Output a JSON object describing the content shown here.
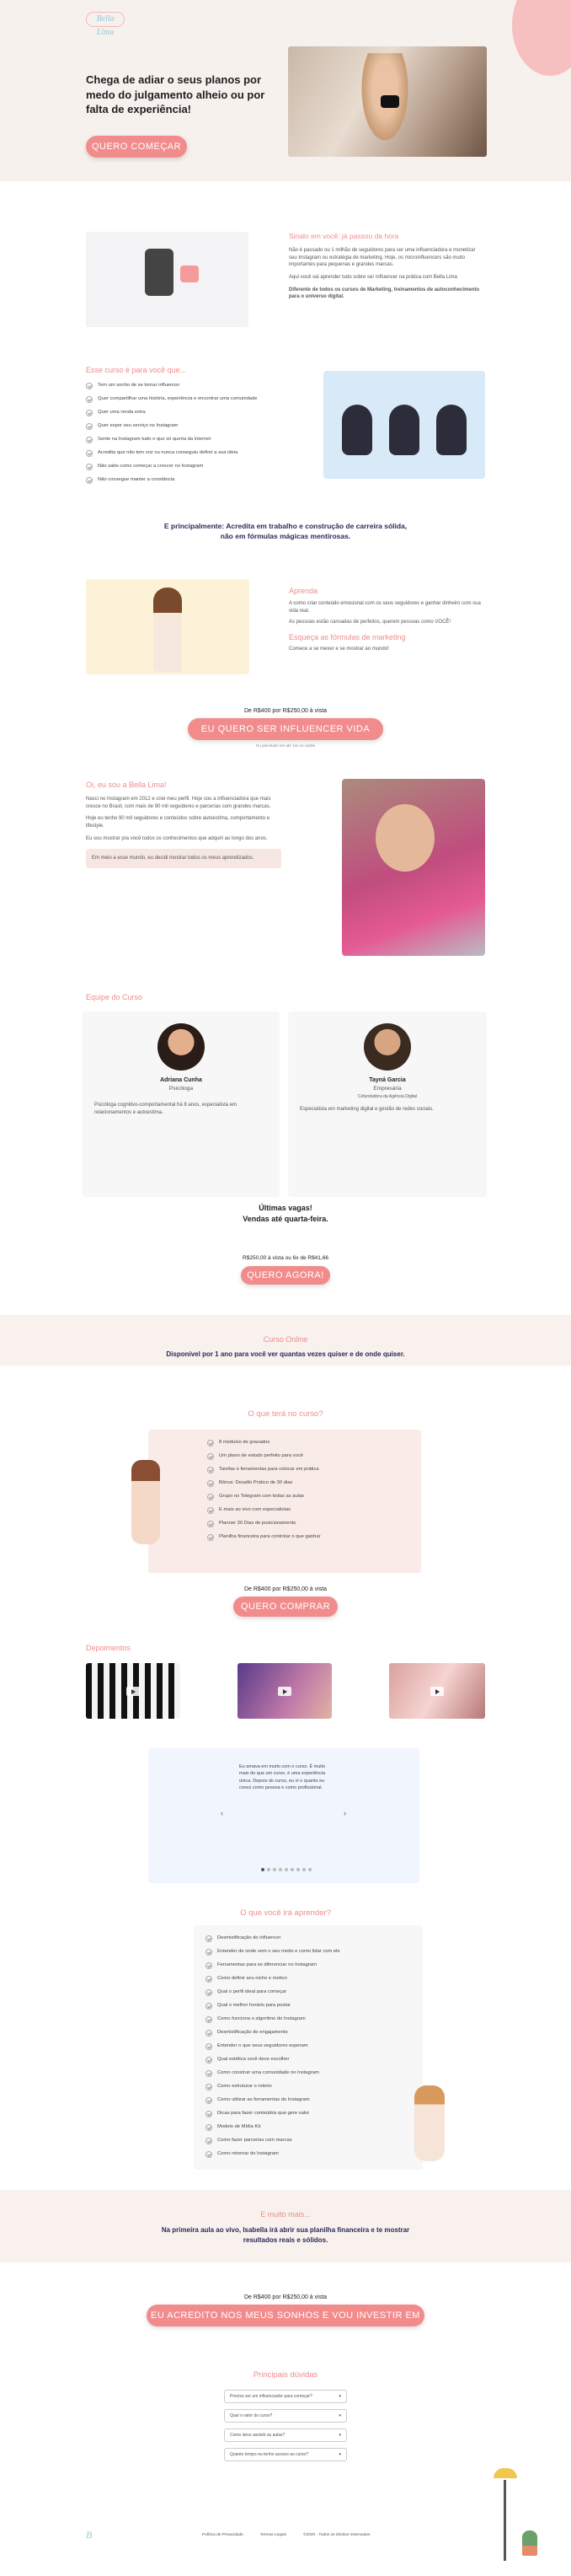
{
  "brand": "Bella Lima",
  "hero": {
    "title": "Chega de adiar o seus planos por medo do julgamento alheio ou por falta de experiência!",
    "cta": "QUERO COMEÇAR"
  },
  "intro": {
    "heading": "Sinalo em você: já passou da hora",
    "p1": "Não é passado ou 1 milhão de seguidores para ser uma influenciadora e monetizar seu Instagram ou estratégia de marketing. Hoje, os microinfluencers são muito importantes para pequenas e grandes marcas.",
    "p2": "Aqui você vai aprender tudo sobre ser influencer na prática com Bella Lima",
    "p3": "Diferente de todos os cursos de Marketing, treinamentos de autoconhecimento para o universo digital."
  },
  "forwho": {
    "heading": "Esse curso é para você que...",
    "items": [
      "Tem um sonho de se tornar influencer",
      "Quer compartilhar uma história, experiência e encontrar uma comunidade",
      "Quer uma renda extra",
      "Quer expor seu serviço no Instagram",
      "Sente na Instagram tudo o que só queria da internet",
      "Acredita que não tem voz ou nunca conseguiu definir a sua ideia",
      "Não sabe como começar a crescer no Instagram",
      "Não consegue manter a constância"
    ]
  },
  "principle": {
    "text": "E principalmente: Acredita em trabalho e construção de carreira sólida, não em fórmulas mágicas mentirosas."
  },
  "learn": {
    "h1": "Aprenda",
    "p1": "A como criar conteúdo emocional com os seus seguidores e ganhar dinheiro com sua vida real.",
    "p2": "As pessoas estão cansadas de perfeitos, querem pessoas como VOCÊ!",
    "h2": "Esqueça as fórmulas de marketing",
    "p3": "Comece a se mexer e se mostrar ao mundo!"
  },
  "price1": {
    "text": "De R$400 por R$250,00 à vista",
    "cta": "EU QUERO SER INFLUENCER VIDA REAL",
    "note": "Ou parcelado em até 12x no cartão"
  },
  "about": {
    "heading": "Oi, eu sou a Bella Lima!",
    "p1": "Nasci no Instagram em 2012 e criei meu perfil. Hoje sou a influenciadora que mais cresce no Brasil, com mais de 90 mil seguidores e parcerias com grandes marcas.",
    "p2": "Hoje eu tenho 90 mil seguidores e conteúdos sobre autoestima, comportamento e lifestyle.",
    "p3": "Eu sou mostrar pra você todos os conhecimentos que adquiri ao longo dos anos.",
    "quote": "Em meio a esse mundo, eu decidi mostrar todos os meus aprendizados."
  },
  "team": {
    "heading": "Equipe do Curso",
    "members": [
      {
        "name": "Adriana Cunha",
        "role": "Psicóloga",
        "bio": "Psicóloga cognitivo-comportamental há 8 anos, especialista em relacionamentos e autoestima."
      },
      {
        "name": "Tayná Garcia",
        "role": "Empresária",
        "sub": "Cofundadora da Agência Digital",
        "bio": "Especialista em marketing digital e gestão de redes sociais."
      }
    ]
  },
  "urgency": {
    "l1": "Últimas vagas!",
    "l2": "Vendas até quarta-feira.",
    "price": "R$250,00 à vista ou 6x de R$41,66",
    "cta": "QUERO AGORA!"
  },
  "online": {
    "heading": "Curso Online",
    "text": "Disponível por 1 ano para você ver quantas vezes quiser e de onde quiser."
  },
  "included": {
    "heading": "O que terá no curso?",
    "items": [
      "8 módulos de gravados",
      "Um plano de estudo perfeito para você",
      "Tarefas e ferramentas para colocar em prática",
      "Bônus: Desafio Prático de 30 dias",
      "Grupo no Telegram com todas as aulas",
      "E mais ao vivo com especialistas",
      "Planner 30 Dias de posicionamento",
      "Planilha financeira para controlar o que ganhar"
    ]
  },
  "price2": {
    "text": "De R$400 por R$250,00 à vista",
    "cta": "QUERO COMPRAR"
  },
  "testimonials": {
    "heading": "Depoimentos",
    "quote": "Eu amava em muito com o curso. É muito mais do que um curso, é uma experiência única. Depois do curso, eu vi o quanto eu cresci como pessoa e como profissional."
  },
  "learnlist": {
    "heading": "O que você irá aprender?",
    "items": [
      "Desmistificação do influencer",
      "Entender de onde vem o seu medo e como lidar com ele",
      "Ferramentas para se diferenciar no Instagram",
      "Como definir seu nicho e motivo",
      "Qual o perfil ideal para começar",
      "Qual o melhor horário para postar",
      "Como funciona o algoritmo do Instagram",
      "Desmistificação do engajamento",
      "Entender o que seus seguidores esperam",
      "Qual estética você deve escolher",
      "Como construir uma comunidade no Instagram",
      "Como estruturar o roteiro",
      "Como utilizar as ferramentas do Instagram",
      "Dicas para fazer conteúdos que gere valor",
      "Modelo de Mídia Kit",
      "Como fazer parcerias com marcas",
      "Como retornar do Instagram"
    ]
  },
  "more": {
    "heading": "E muito mais...",
    "text": "Na primeira aula ao vivo, Isabella irá abrir sua planilha financeira e te mostrar resultados reais e sólidos."
  },
  "price3": {
    "text": "De R$400 por R$250,00 à vista",
    "cta": "EU ACREDITO NOS MEUS SONHOS E VOU INVESTIR EM MIM!"
  },
  "faq": {
    "heading": "Principais dúvidas",
    "items": [
      "Preciso ser um influenciador para começar?",
      "Qual o valor do curso?",
      "Como devo assistir as aulas?",
      "Quanto tempo eu tenho acesso ao curso?"
    ]
  },
  "footer": {
    "links": [
      "Política de Privacidade",
      "Termos Legais",
      "©2020 · Todos os direitos reservados"
    ]
  }
}
